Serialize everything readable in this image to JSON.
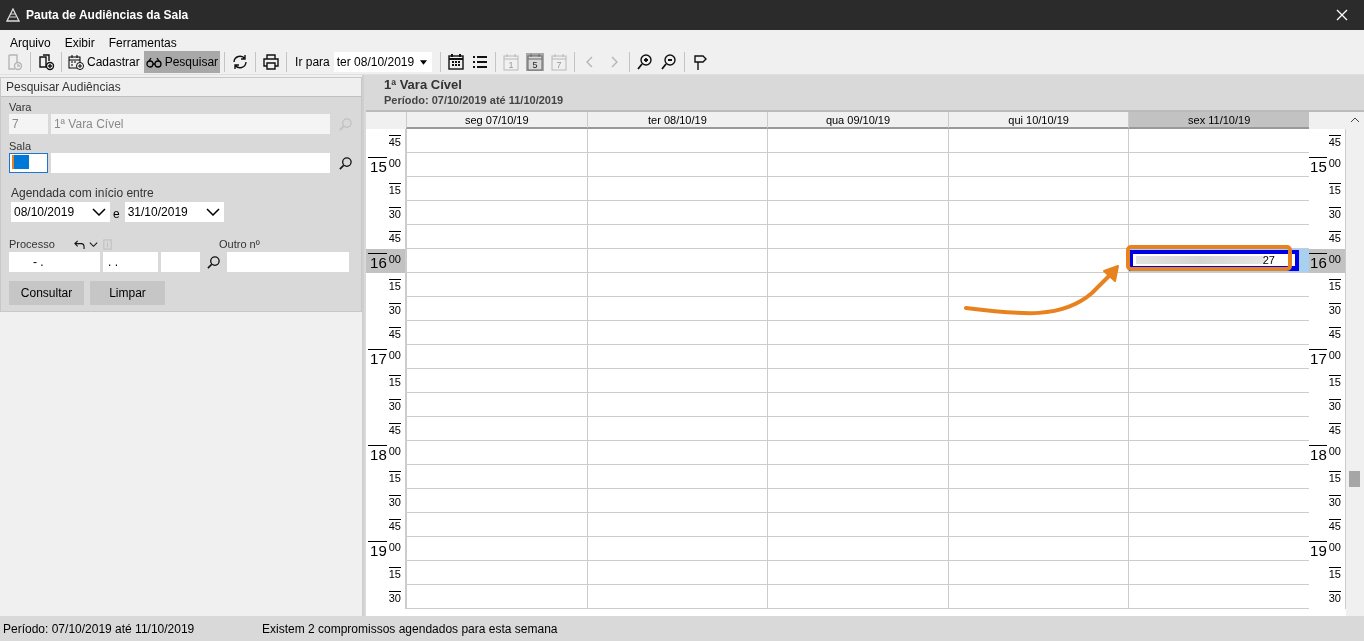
{
  "window": {
    "title": "Pauta de Audiências da Sala"
  },
  "menu": [
    "Arquivo",
    "Exibir",
    "Ferramentas"
  ],
  "toolbar": [
    {
      "kind": "history",
      "disabled": true
    },
    {
      "kind": "sep"
    },
    {
      "kind": "copy",
      "disabled": false
    },
    {
      "kind": "sep"
    },
    {
      "kind": "register",
      "label": "Cadastrar",
      "selected": false
    },
    {
      "kind": "search",
      "label": "Pesquisar",
      "selected": true
    },
    {
      "kind": "sep"
    },
    {
      "kind": "refresh",
      "disabled": false
    },
    {
      "kind": "sep"
    },
    {
      "kind": "print",
      "disabled": false
    },
    {
      "kind": "sep"
    },
    {
      "kind": "goto",
      "label": "Ir para",
      "value": "ter 08/10/2019"
    },
    {
      "kind": "sep"
    },
    {
      "kind": "calendar",
      "disabled": false
    },
    {
      "kind": "list",
      "disabled": false
    },
    {
      "kind": "sep"
    },
    {
      "kind": "day",
      "label": "1",
      "selected": false
    },
    {
      "kind": "day",
      "label": "5",
      "selected": true
    },
    {
      "kind": "day",
      "label": "7",
      "selected": false
    },
    {
      "kind": "sep"
    },
    {
      "kind": "prev",
      "disabled": true
    },
    {
      "kind": "next",
      "disabled": true
    },
    {
      "kind": "sep"
    },
    {
      "kind": "zoomin",
      "disabled": false
    },
    {
      "kind": "zoomout",
      "disabled": false
    },
    {
      "kind": "sep"
    },
    {
      "kind": "pin",
      "disabled": false
    }
  ],
  "search_panel": {
    "title": "Pesquisar Audiências",
    "vara": {
      "label": "Vara",
      "code": "7",
      "name": "1ª Vara Cível",
      "disabled": true
    },
    "sala": {
      "label": "Sala",
      "focused": true
    },
    "date_range": {
      "label": "Agendada com início entre",
      "from": "08/10/2019",
      "joiner": "e",
      "to": "31/10/2019"
    },
    "processo": {
      "label": "Processo",
      "part_1": "- .",
      "part_2": ". .",
      "other_label": "Outro nº"
    },
    "buttons": [
      "Consultar",
      "Limpar"
    ]
  },
  "calendar": {
    "title": "1ª Vara Cível",
    "period": "Período: 07/10/2019 até 11/10/2019",
    "days": [
      {
        "label": "seg 07/10/19",
        "selected": false
      },
      {
        "label": "ter 08/10/19",
        "selected": false
      },
      {
        "label": "qua 09/10/19",
        "selected": false
      },
      {
        "label": "qui 10/10/19",
        "selected": false
      },
      {
        "label": "sex 11/10/19",
        "selected": true
      }
    ],
    "appointment": {
      "text": "27"
    },
    "time_labels_left": [
      {
        "minute": "45",
        "selected": false
      },
      {
        "hour": "15",
        "minute": "00",
        "selected": false
      },
      {
        "minute": "15",
        "selected": false
      },
      {
        "minute": "30",
        "selected": false
      },
      {
        "minute": "45",
        "selected": false
      },
      {
        "hour": "16",
        "minute": "00",
        "selected": true
      },
      {
        "minute": "15",
        "selected": false
      },
      {
        "minute": "30",
        "selected": false
      },
      {
        "minute": "45",
        "selected": false
      },
      {
        "hour": "17",
        "minute": "00",
        "selected": false
      },
      {
        "minute": "15",
        "selected": false
      },
      {
        "minute": "30",
        "selected": false
      },
      {
        "minute": "45",
        "selected": false
      },
      {
        "hour": "18",
        "minute": "00",
        "selected": false
      },
      {
        "minute": "15",
        "selected": false
      },
      {
        "minute": "30",
        "selected": false
      },
      {
        "minute": "45",
        "selected": false
      },
      {
        "hour": "19",
        "minute": "00",
        "selected": false
      },
      {
        "minute": "15",
        "selected": false
      },
      {
        "minute": "30",
        "selected": false
      }
    ],
    "time_labels_right": [
      {
        "minute": "45",
        "selected": false
      },
      {
        "hour": "15",
        "minute": "00",
        "selected": false
      },
      {
        "minute": "15",
        "selected": false
      },
      {
        "minute": "30",
        "selected": false
      },
      {
        "minute": "45",
        "selected": false
      },
      {
        "hour": "16",
        "minute": "00",
        "selected": true
      },
      {
        "minute": "15",
        "selected": false
      },
      {
        "minute": "30",
        "selected": false
      },
      {
        "minute": "45",
        "selected": false
      },
      {
        "hour": "17",
        "minute": "00",
        "selected": false
      },
      {
        "minute": "15",
        "selected": false
      },
      {
        "minute": "30",
        "selected": false
      },
      {
        "minute": "45",
        "selected": false
      },
      {
        "hour": "18",
        "minute": "00",
        "selected": false
      },
      {
        "minute": "15",
        "selected": false
      },
      {
        "minute": "30",
        "selected": false
      },
      {
        "minute": "45",
        "selected": false
      },
      {
        "hour": "19",
        "minute": "00",
        "selected": false
      },
      {
        "minute": "15",
        "selected": false
      },
      {
        "minute": "30",
        "selected": false
      }
    ]
  },
  "status_bar": [
    "Período: 07/10/2019 até 11/10/2019",
    "Existem 2 compromissos agendados para esta semana"
  ]
}
